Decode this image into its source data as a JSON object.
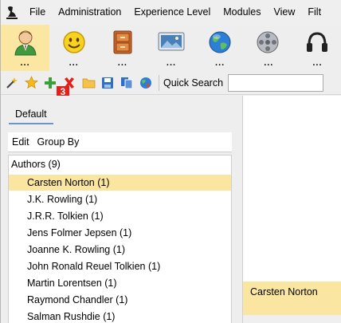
{
  "menu": {
    "items": [
      "File",
      "Administration",
      "Experience Level",
      "Modules",
      "View",
      "Filt"
    ]
  },
  "modules": [
    {
      "icon": "user-profile-icon",
      "dots": "...",
      "selected": true
    },
    {
      "icon": "smiley-icon",
      "dots": "...",
      "selected": false
    },
    {
      "icon": "cabinet-icon",
      "dots": "...",
      "selected": false
    },
    {
      "icon": "picture-monitor-icon",
      "dots": "...",
      "selected": false
    },
    {
      "icon": "globe-icon",
      "dots": "...",
      "selected": false
    },
    {
      "icon": "film-reel-icon",
      "dots": "...",
      "selected": false
    },
    {
      "icon": "headphones-icon",
      "dots": "...",
      "selected": false
    }
  ],
  "toolbar": {
    "quick_search_label": "Quick Search",
    "quick_search_value": "",
    "badge": "3"
  },
  "left_panel": {
    "tab": "Default",
    "edit_label": "Edit",
    "group_by_label": "Group By",
    "tree_root": "Authors (9)",
    "authors": [
      "Carsten Norton (1)",
      "J.K. Rowling (1)",
      "J.R.R. Tolkien (1)",
      "Jens Folmer Jepsen (1)",
      "Joanne K. Rowling (1)",
      "John Ronald Reuel Tolkien (1)",
      "Martin Lorentsen (1)",
      "Raymond Chandler (1)",
      "Salman Rushdie (1)"
    ]
  },
  "right_pane": {
    "selected_name": "Carsten Norton"
  },
  "colors": {
    "selection": "#fae6a0",
    "badge": "#e2211c",
    "tab_underline": "#6a97c9"
  }
}
